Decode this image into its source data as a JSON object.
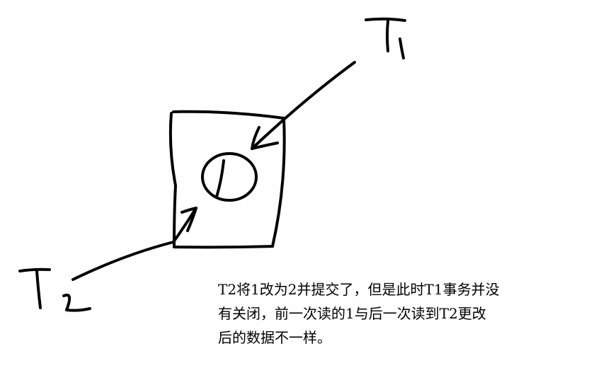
{
  "diagram": {
    "t1_label": "T1",
    "t2_label": "T2",
    "cell_value": "1",
    "caption_lines": [
      "T2将1改为2并提交了，但是此时T1事务并没",
      "有关闭，前一次读的1与后一次读到T2更改",
      "后的数据不一样。"
    ]
  }
}
